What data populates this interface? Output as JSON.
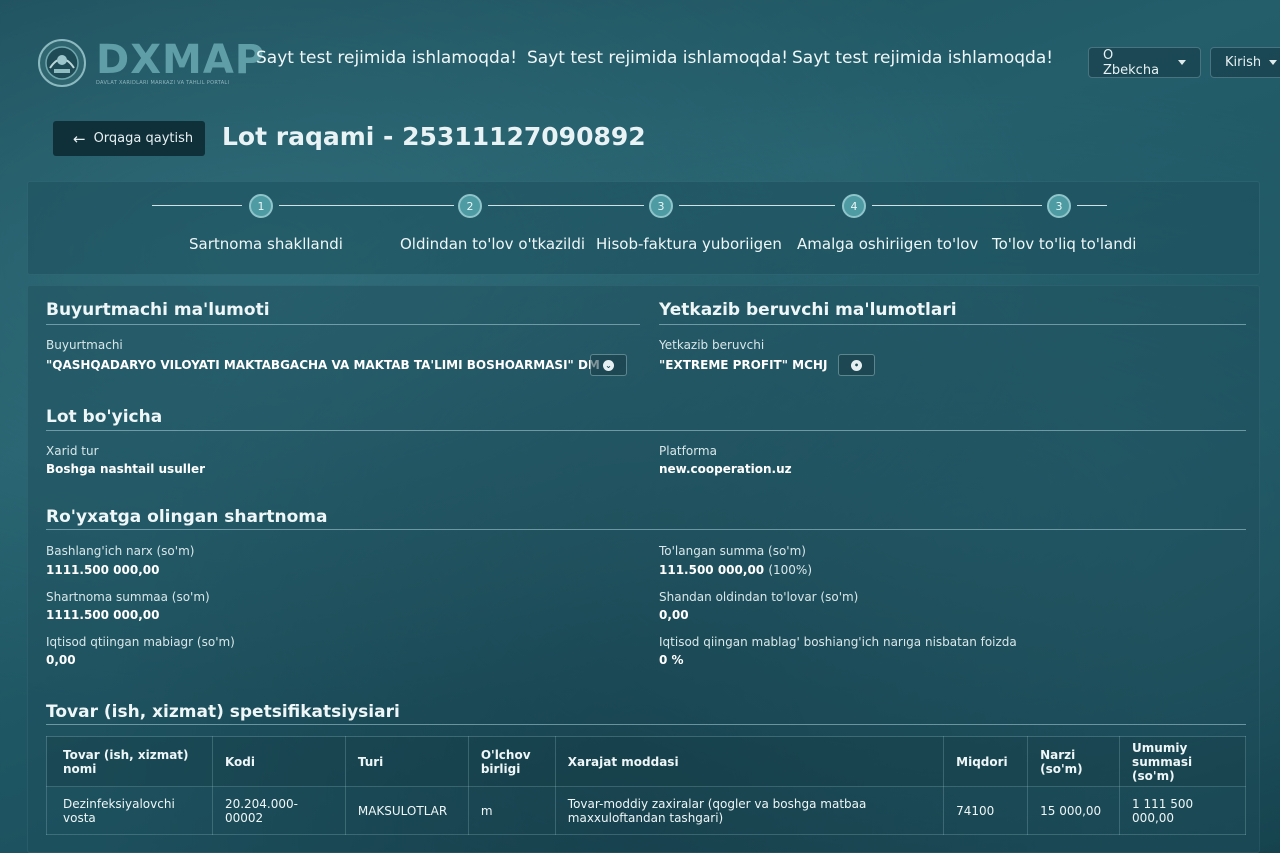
{
  "header": {
    "logo_text": "DXMAP",
    "logo_subtitle": "DAVLAT XARIDLARI MARKAZI VA TAHLIL PORTALI",
    "marquee": [
      "Sayt test rejimida ishlamoqda!",
      "Sayt test rejimida ishlamoqda!",
      "Sayt test rejimida ishlamoqda!"
    ],
    "language": "O Zbekcha",
    "login": "Kirish"
  },
  "page": {
    "back_label": "Orqaga qaytish",
    "title": "Lot raqami - 25311127090892"
  },
  "stepper": {
    "steps": [
      {
        "number": "1",
        "label": "Sartnoma shakllandi"
      },
      {
        "number": "2",
        "label": "Oldindan to'lov o'tkazildi"
      },
      {
        "number": "3",
        "label": "Hisob-faktura yuboriigen"
      },
      {
        "number": "4",
        "label": "Amalga oshiriigen to'lov"
      },
      {
        "number": "3",
        "label": "To'lov to'liq to'landi"
      }
    ]
  },
  "customer": {
    "section_title": "Buyurtmachi ma'lumoti",
    "label": "Buyurtmachi",
    "value": "\"QASHQADARYO VILOYATI MAKTABGACHA VA MAKTAB TA'LIMI BOSHOARMASI\" DM"
  },
  "supplier": {
    "section_title": "Yetkazib beruvchi ma'lumotlari",
    "label": "Yetkazib beruvchi",
    "value": "\"EXTREME PROFIT\" MCHJ"
  },
  "lot": {
    "section_title": "Lot bo'yicha",
    "purchase_type_label": "Xarid tur",
    "purchase_type_value": "Boshga nashtail usuller",
    "platform_label": "Platforma",
    "platform_value": "new.cooperation.uz"
  },
  "contract": {
    "section_title": "Ro'yxatga olingan shartnoma",
    "start_price_label": "Bashlang'ich narx (so'm)",
    "start_price_value": "1111.500 000,00",
    "paid_label": "To'langan summa (so'm)",
    "paid_value": "111.500 000,00",
    "paid_percent": "(100%)",
    "contract_sum_label": "Shartnoma summaa (so'm)",
    "contract_sum_value": "1111.500 000,00",
    "prepaid_label": "Shandan oldindan to'lovar (so'm)",
    "prepaid_value": "0,00",
    "saved_label": "Iqtisod qtiingan mabiagr (so'm)",
    "saved_value": "0,00",
    "saved_percent_label": "Iqtisod qiingan mablag' boshiang'ich narıga nisbatan foizda",
    "saved_percent_value": "0 %"
  },
  "spec": {
    "section_title": "Tovar (ish, xizmat) spetsifikatsiysiari",
    "columns": [
      "Tovar (ish, xizmat) nomi",
      "Kodi",
      "Turi",
      "O'lchov birligi",
      "Xarajat moddasi",
      "Miqdori",
      "Narzi (so'm)",
      "Umumiy summasi (so'm)"
    ],
    "rows": [
      [
        "Dezinfeksiyalovchi vosta",
        "20.204.000-00002",
        "MAKSULOTLAR",
        "m",
        "Tovar-moddiy zaxiralar (qogler va boshga matbaa maxxuloftandan tashgari)",
        "74100",
        "15 000,00",
        "1 111 500 000,00"
      ]
    ]
  }
}
